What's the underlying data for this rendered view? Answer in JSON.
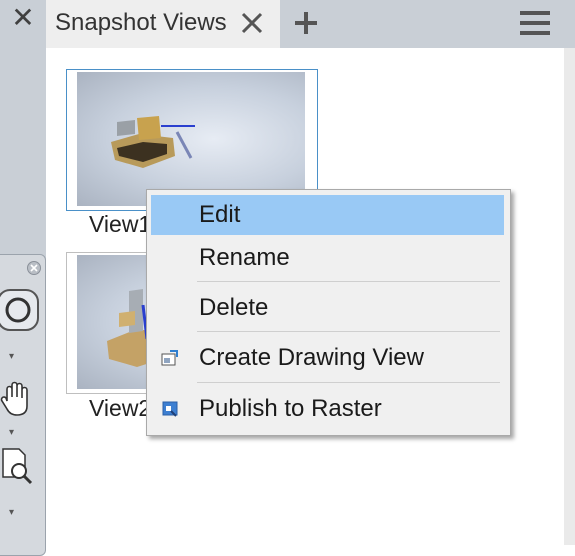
{
  "panel": {
    "close_icon": "close-icon",
    "tab": {
      "title": "Snapshot Views",
      "close_icon": "close-icon"
    },
    "add_tab_icon": "plus-icon",
    "menu_icon": "hamburger-menu-icon"
  },
  "navigation_palette": {
    "icons": [
      "close-icon",
      "zoom-icon",
      "chevron-down-icon",
      "pan-hand-icon",
      "chevron-down-icon",
      "zoom-window-icon",
      "chevron-down-icon"
    ]
  },
  "snapshots": [
    {
      "label": "View1"
    },
    {
      "label": "View2"
    }
  ],
  "context_menu": {
    "items": [
      {
        "label": "Edit",
        "highlighted": true,
        "icon": null
      },
      {
        "label": "Rename",
        "icon": null
      },
      {
        "label": "Delete",
        "icon": null
      },
      {
        "label": "Create Drawing View",
        "icon": "drawing-view-icon"
      },
      {
        "label": "Publish to Raster",
        "icon": "raster-image-icon"
      }
    ]
  },
  "colors": {
    "highlight": "#99c9f5",
    "tab_background": "#eeeeee",
    "chrome_background": "#c9cfd6"
  }
}
